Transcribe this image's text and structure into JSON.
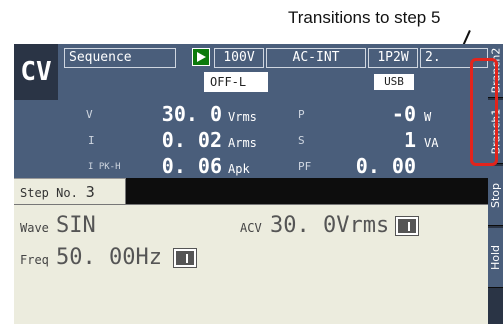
{
  "annotation": "Transitions to step 5",
  "mode": "CV",
  "header": {
    "sequence": "Sequence",
    "voltage_range": "100V",
    "source": "AC-INT",
    "wiring": "1P2W",
    "wiring_extra": "2.",
    "output_state": "OFF-L",
    "usb": "USB"
  },
  "measurements": {
    "v_label": "V",
    "v_value": "30. 0",
    "v_unit": "Vrms",
    "i_label": "I",
    "i_value": "0. 02",
    "i_unit": "Arms",
    "ipk_label": "I PK-H",
    "ipk_value": "0. 06",
    "ipk_unit": "Apk",
    "p_label": "P",
    "p_value": "-0",
    "p_unit": "W",
    "s_label": "S",
    "s_value": "1",
    "s_unit": "VA",
    "pf_label": "PF",
    "pf_value": "0. 00"
  },
  "step": {
    "label": "Step No.",
    "number": "3"
  },
  "fields": {
    "wave_label": "Wave",
    "wave_value": "SIN",
    "acv_label": "ACV",
    "acv_value": "30. 0Vrms",
    "freq_label": "Freq",
    "freq_value": "50. 00Hz"
  },
  "side_buttons": [
    "Branch2",
    "Branch1",
    "Stop",
    "Hold"
  ],
  "colors": {
    "highlight": "#e2241c",
    "panel_blue": "#4a5e7b",
    "panel_beige": "#ececde"
  }
}
